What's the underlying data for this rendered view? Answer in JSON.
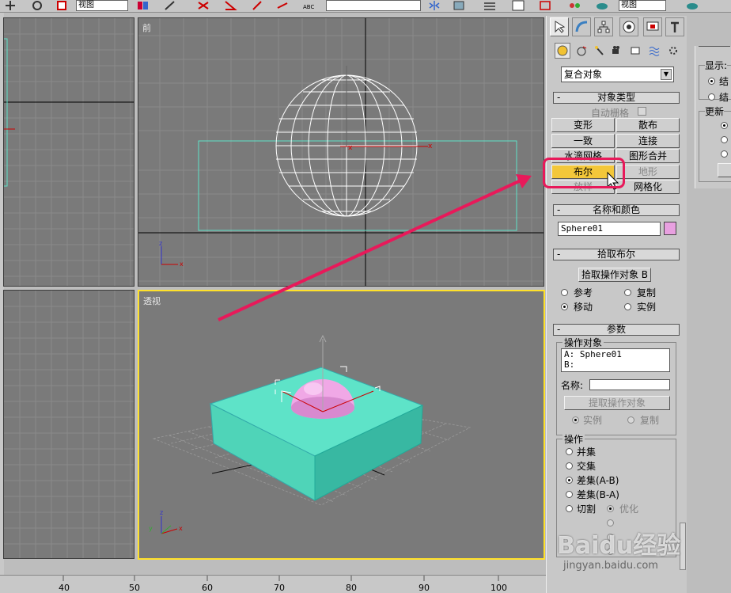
{
  "toolbar": {
    "view_combo_left": "视图",
    "view_combo_right": "视图"
  },
  "viewports": {
    "front_label": "前",
    "perspective_label": "透视",
    "axis_x": "x",
    "axis_y": "y",
    "axis_z": "z"
  },
  "ruler": {
    "ticks": [
      "40",
      "50",
      "60",
      "70",
      "80",
      "90",
      "100"
    ]
  },
  "command_panel": {
    "category_dropdown": "复合对象",
    "object_type": {
      "title": "对象类型",
      "autogrid_label": "自动栅格",
      "buttons": [
        "变形",
        "散布",
        "一致",
        "连接",
        "水滴网格",
        "图形合并",
        "布尔",
        "地形",
        "放样",
        "网格化"
      ]
    },
    "name_color": {
      "title": "名称和颜色",
      "name_value": "Sphere01",
      "color": "#e8a0e0"
    },
    "pick_boolean": {
      "title": "拾取布尔",
      "pick_button": "拾取操作对象 B",
      "options": [
        "参考",
        "复制",
        "移动",
        "实例"
      ],
      "selected": "移动"
    },
    "parameters": {
      "title": "参数",
      "operands_group": "操作对象",
      "operand_a": "A: Sphere01",
      "operand_b": "B:",
      "name_label": "名称:",
      "extract_button": "提取操作对象",
      "extract_options": [
        "实例",
        "复制"
      ],
      "operation_group": "操作",
      "operations": [
        "并集",
        "交集",
        "差集(A-B)",
        "差集(B-A)",
        "切割"
      ],
      "selected_operation": "差集(A-B)",
      "cut_option": "优化"
    }
  },
  "right_panel": {
    "display_label": "显示:",
    "display_item1": "结",
    "display_item2": "结",
    "update_label": "更新"
  },
  "watermark": {
    "brand": "Baidu经验",
    "url": "jingyan.baidu.com"
  },
  "colors": {
    "highlight": "#e8195a",
    "selected_button": "#f3c73a",
    "box_teal": "#5ee3c8",
    "sphere_pink": "#f0a8e6",
    "active_viewport_border": "#ffe12a"
  }
}
